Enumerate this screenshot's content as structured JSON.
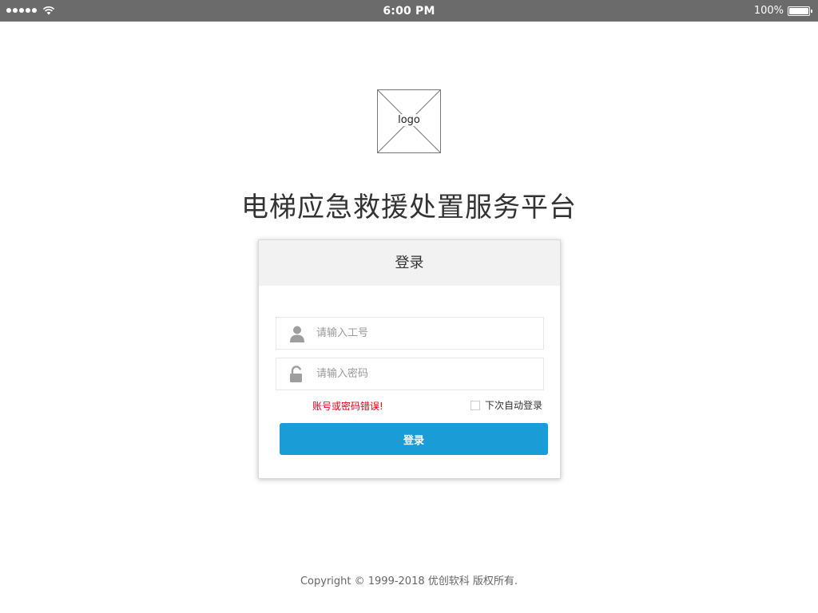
{
  "status_bar": {
    "time": "6:00 PM",
    "battery_percent": "100%",
    "signal_icon": "signal-dots-icon",
    "wifi_icon": "wifi-icon",
    "battery_icon": "battery-full-icon",
    "battery_level": 1.0
  },
  "logo": {
    "label": "logo"
  },
  "app_title": "电梯应急救援处置服务平台",
  "login_card": {
    "header": "登录",
    "username": {
      "icon": "user-icon",
      "value": "",
      "placeholder": "请输入工号"
    },
    "password": {
      "icon": "unlock-icon",
      "value": "",
      "placeholder": "请输入密码"
    },
    "error_message": "账号或密码错误!",
    "remember_label": "下次自动登录",
    "remember_checked": false,
    "submit_label": "登录"
  },
  "footer": {
    "copyright": "Copyright © 1999-2018 优创软科 版权所有."
  },
  "colors": {
    "status_bar_bg": "#6b6b6b",
    "primary_button": "#1a9cd6",
    "error_text": "#e0001b",
    "card_header_bg": "#f2f2f2"
  }
}
